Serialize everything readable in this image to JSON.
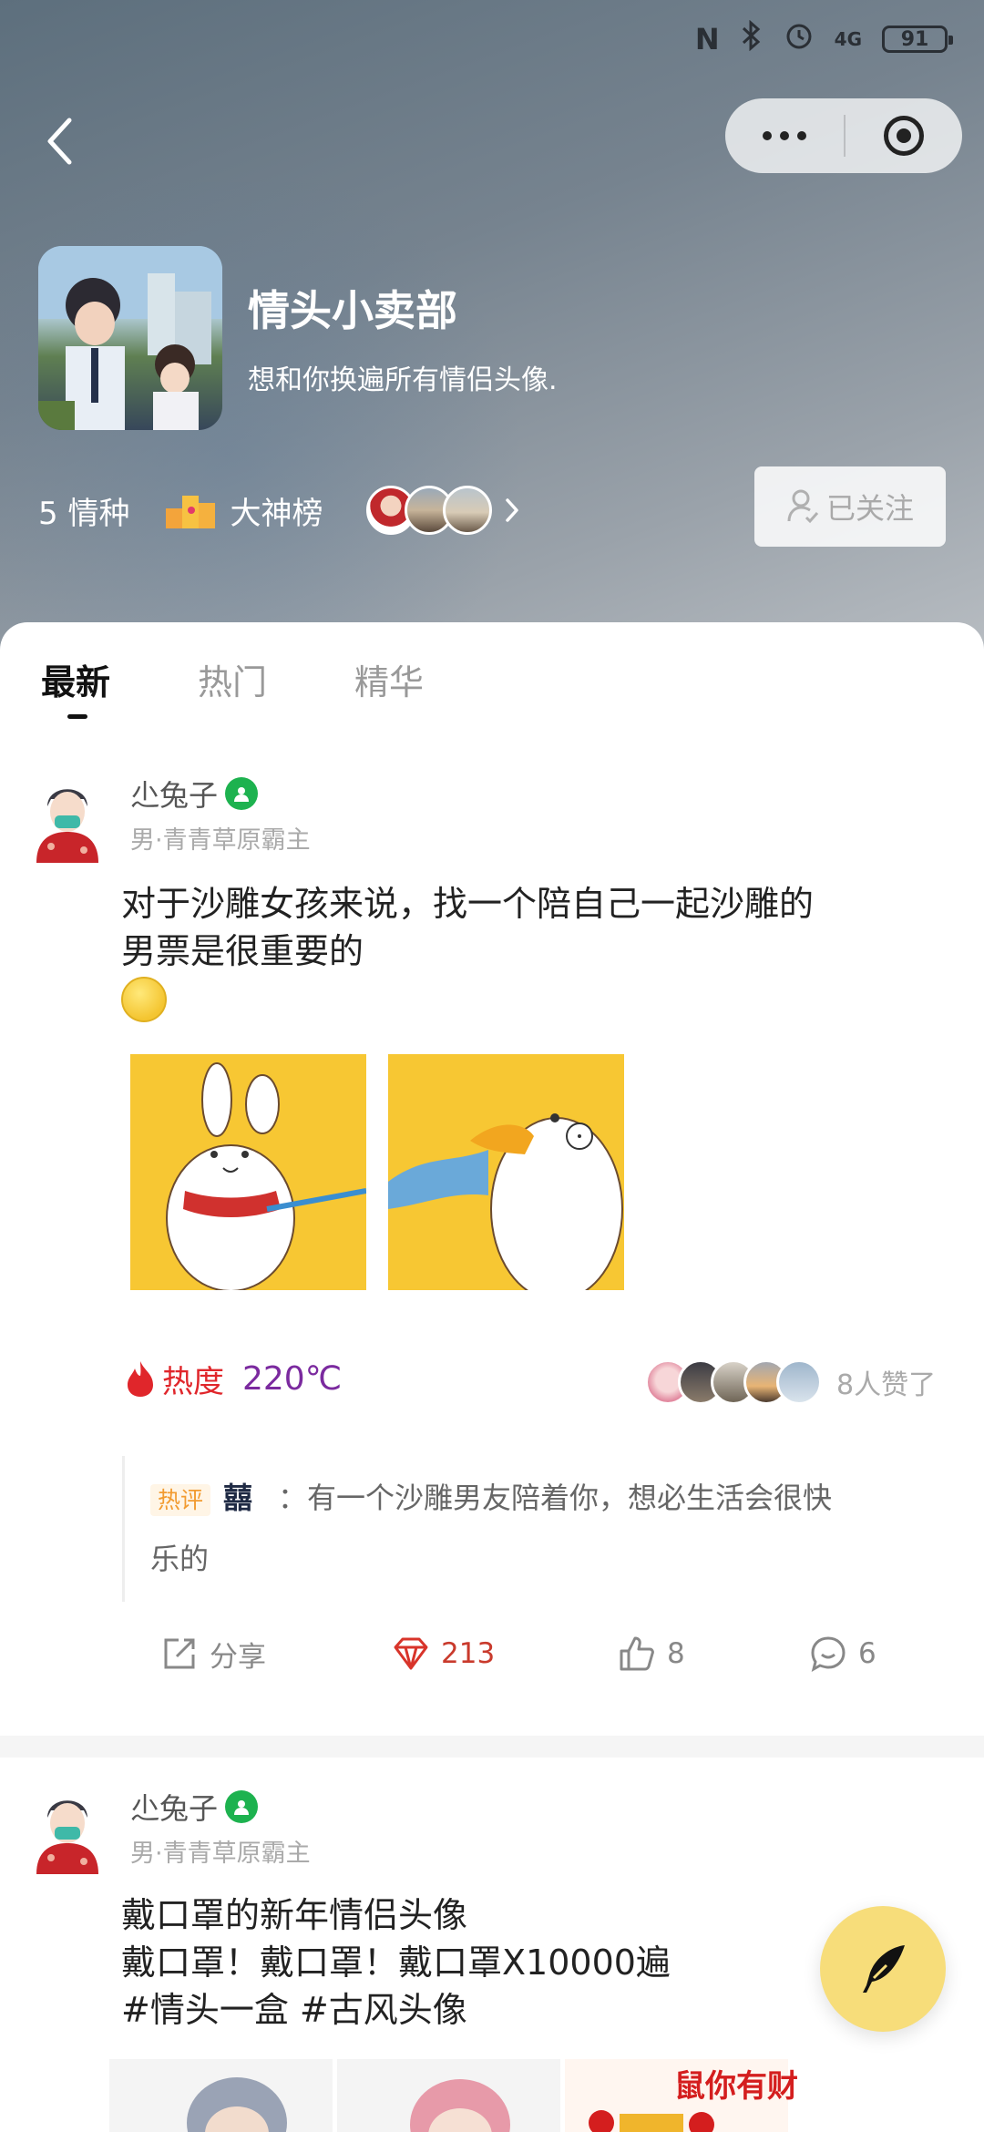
{
  "status_bar": {
    "icons": [
      "nfc-icon",
      "bluetooth-icon",
      "alarm-icon"
    ],
    "network": "4G",
    "battery": "91"
  },
  "header": {
    "group_title": "情头小卖部",
    "group_desc": "想和你换遍所有情侣头像.",
    "count_number": "5",
    "count_label": "情种",
    "ranking_label": "大神榜",
    "follow_label": "已关注"
  },
  "tabs": [
    {
      "label": "最新",
      "active": true
    },
    {
      "label": "热门",
      "active": false
    },
    {
      "label": "精华",
      "active": false
    }
  ],
  "posts": [
    {
      "author": "尐兔子",
      "sub": "男·青青草原霸主",
      "text_line1": "对于沙雕女孩来说，找一个陪自己一起沙雕的",
      "text_line2": "男票是很重要的",
      "heat_label": "热度",
      "heat_value": "220℃",
      "likes_text": "8人赞了",
      "hot_comment_tag": "热评",
      "hot_comment_user": "囍",
      "hot_comment_line1": "：有一个沙雕男友陪着你，想必生活会很快",
      "hot_comment_line2": "乐的",
      "actions": {
        "share": "分享",
        "gems": "213",
        "likes": "8",
        "comments": "6"
      }
    },
    {
      "author": "尐兔子",
      "sub": "男·青青草原霸主",
      "text_line1": "戴口罩的新年情侣头像",
      "text_line2": "戴口罩！戴口罩！戴口罩X10000遍",
      "text_line3": "#情头一盒 #古风头像",
      "banner_text": "鼠你有财"
    }
  ],
  "colors": {
    "accent_red": "#e0262b",
    "heat_value": "#7b2a9f",
    "verified_green": "#1db24f",
    "fab_yellow": "#f7dd7a"
  }
}
